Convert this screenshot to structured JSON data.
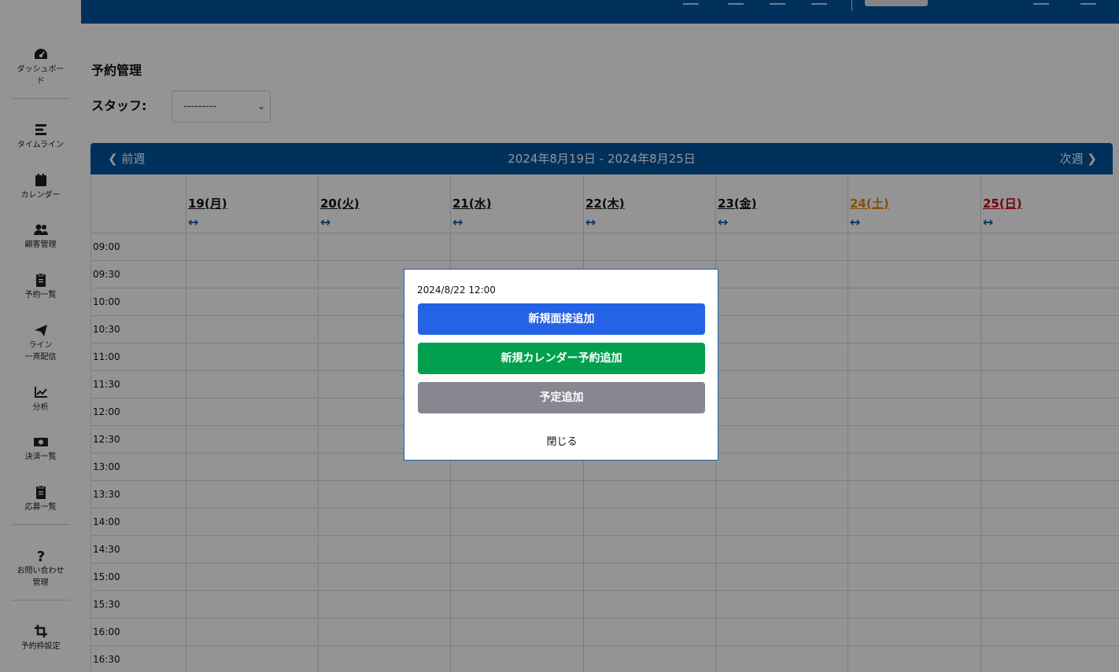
{
  "sidebar": {
    "items": [
      {
        "label": "ダッシュボー\nド",
        "icon": "dashboard-gauge-icon"
      },
      {
        "label": "タイムライン",
        "icon": "timeline-icon"
      },
      {
        "label": "カレンダー",
        "icon": "calendar-icon"
      },
      {
        "label": "顧客管理",
        "icon": "users-icon"
      },
      {
        "label": "予約一覧",
        "icon": "clipboard-list-icon"
      },
      {
        "label": "ライン\n一斉配信",
        "icon": "paper-plane-icon"
      },
      {
        "label": "分析",
        "icon": "chart-line-icon"
      },
      {
        "label": "決済一覧",
        "icon": "money-bill-icon"
      },
      {
        "label": "応募一覧",
        "icon": "clipboard-list-icon"
      },
      {
        "label": "お問い合わせ\n管理",
        "icon": "question-icon"
      },
      {
        "label": "予約枠設定",
        "icon": "crop-icon"
      }
    ]
  },
  "page": {
    "title": "予約管理",
    "staff_label": "スタッフ:",
    "staff_value": "---------"
  },
  "calendar": {
    "prev_label": "前週",
    "next_label": "次週",
    "range": "2024年8月19日 - 2024年8月25日",
    "arrow": "↔",
    "days": [
      {
        "label": "19(月)",
        "color": "#111111"
      },
      {
        "label": "20(火)",
        "color": "#111111"
      },
      {
        "label": "21(水)",
        "color": "#111111"
      },
      {
        "label": "22(木)",
        "color": "#111111"
      },
      {
        "label": "23(金)",
        "color": "#111111"
      },
      {
        "label": "24(土)",
        "color": "#e8870e"
      },
      {
        "label": "25(日)",
        "color": "#d0021b"
      }
    ],
    "times": [
      "09:00",
      "09:30",
      "10:00",
      "10:30",
      "11:00",
      "11:30",
      "12:00",
      "12:30",
      "13:00",
      "13:30",
      "14:00",
      "14:30",
      "15:00",
      "15:30",
      "16:00",
      "16:30"
    ]
  },
  "modal": {
    "datetime": "2024/8/22 12:00",
    "btn_interview": "新規面接追加",
    "btn_calendar": "新規カレンダー予約追加",
    "btn_schedule": "予定追加",
    "btn_close": "閉じる"
  },
  "colors": {
    "primary": "#00539f",
    "interview": "#2563e6",
    "calendar": "#00a04e",
    "schedule": "#868791",
    "highlight": "#ff9b1a"
  }
}
